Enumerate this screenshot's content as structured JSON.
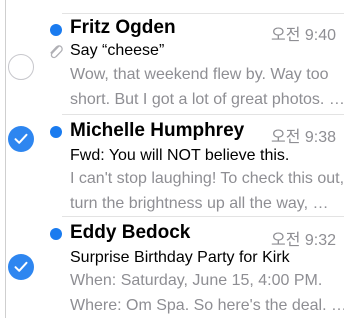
{
  "messages": [
    {
      "sender": "Fritz Ogden",
      "time": "오전 9:40",
      "subject": "Say “cheese”",
      "preview_line1": "Wow, that weekend flew by. Way too",
      "preview_line2": "short. But I got a lot of great photos. …",
      "unread": true,
      "has_attachment": true,
      "selected": false
    },
    {
      "sender": "Michelle Humphrey",
      "time": "오전 9:38",
      "subject": "Fwd: You will NOT believe this.",
      "preview_line1": "I can't stop laughing! To check this out,",
      "preview_line2": "turn the brightness up all the way, …",
      "unread": true,
      "has_attachment": false,
      "selected": true
    },
    {
      "sender": "Eddy Bedock",
      "time": "오전 9:32",
      "subject": "Surprise Birthday Party for Kirk",
      "preview_line1": "When: Saturday, June 15, 4:00 PM.",
      "preview_line2": "Where: Om Spa. So here's the deal. …",
      "unread": true,
      "has_attachment": false,
      "selected": true
    }
  ],
  "colors": {
    "accent": "#2e86f0",
    "unread_dot": "#1a7bef",
    "secondary_text": "#8e8e93"
  },
  "icons": {
    "selected": "checkmark-icon",
    "attachment": "paperclip-icon"
  }
}
